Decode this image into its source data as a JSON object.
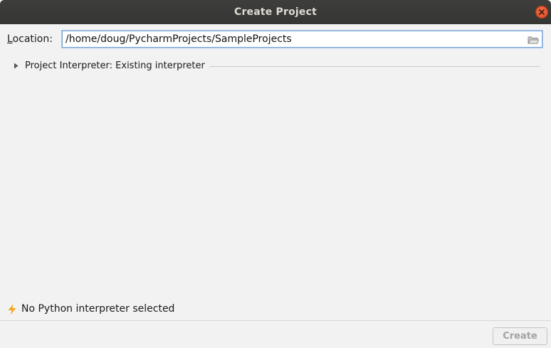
{
  "window": {
    "title": "Create Project"
  },
  "location": {
    "label_mnemonic": "L",
    "label_rest": "ocation:",
    "value": "/home/doug/PycharmProjects/SampleProjects"
  },
  "interpreter": {
    "label": "Project Interpreter: Existing interpreter",
    "expanded": false
  },
  "status": {
    "text": "No Python interpreter selected",
    "icon": "lightning-icon",
    "icon_color": "#f2a81d"
  },
  "buttons": {
    "create_label": "Create",
    "create_enabled": false
  },
  "colors": {
    "titlebar": "#3c3b37",
    "close_button": "#e95420",
    "focus_border": "#7aa6d8"
  }
}
